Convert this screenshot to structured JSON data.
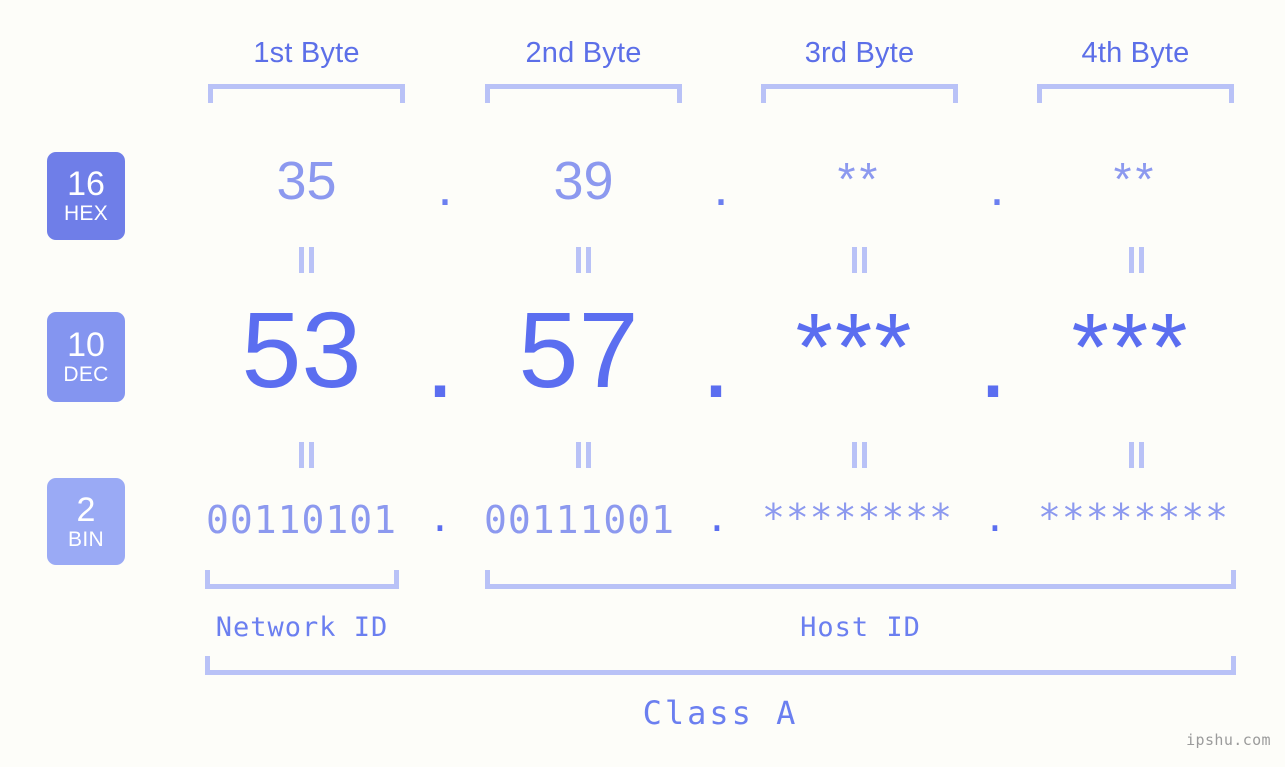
{
  "page": {
    "background_color": "#fdfdf9",
    "watermark": "ipshu.com"
  },
  "colors": {
    "accent_strong": "#5b6ef0",
    "accent_mid": "#6b7ff0",
    "accent_light": "#8c99ef",
    "bracket": "#b9c2f7",
    "badge_hex": "#6f7ee8",
    "badge_dec": "#8495f0",
    "badge_bin": "#9aaaf5"
  },
  "byte_headers": [
    {
      "label": "1st Byte"
    },
    {
      "label": "2nd Byte"
    },
    {
      "label": "3rd Byte"
    },
    {
      "label": "4th Byte"
    }
  ],
  "radix_badges": [
    {
      "number": "16",
      "name": "HEX",
      "color": "#6f7ee8"
    },
    {
      "number": "10",
      "name": "DEC",
      "color": "#8495f0"
    },
    {
      "number": "2",
      "name": "BIN",
      "color": "#9aaaf5"
    }
  ],
  "rows": {
    "hex": {
      "radix": "16",
      "radix_name": "HEX",
      "values": [
        "35",
        "39",
        "**",
        "**"
      ],
      "separators": [
        ".",
        ".",
        "."
      ]
    },
    "dec": {
      "radix": "10",
      "radix_name": "DEC",
      "values": [
        "53",
        "57",
        "***",
        "***"
      ],
      "separators": [
        ".",
        ".",
        "."
      ]
    },
    "bin": {
      "radix": "2",
      "radix_name": "BIN",
      "values": [
        "00110101",
        "00111001",
        "********",
        "********"
      ],
      "separators": [
        ".",
        ".",
        "."
      ]
    }
  },
  "equality_marks": {
    "glyph": "=",
    "count_per_gap": 4,
    "gaps": 2
  },
  "sections": {
    "network_id": {
      "label": "Network ID",
      "spans_bytes": [
        1
      ]
    },
    "host_id": {
      "label": "Host ID",
      "spans_bytes": [
        2,
        3,
        4
      ]
    },
    "class": {
      "label": "Class A",
      "spans_bytes": [
        1,
        2,
        3,
        4
      ]
    }
  },
  "ip_address": {
    "hex": "35.39.**.**",
    "dec": "53.57.***.***",
    "bin": "00110101.00111001.********.********",
    "class": "Class A"
  }
}
